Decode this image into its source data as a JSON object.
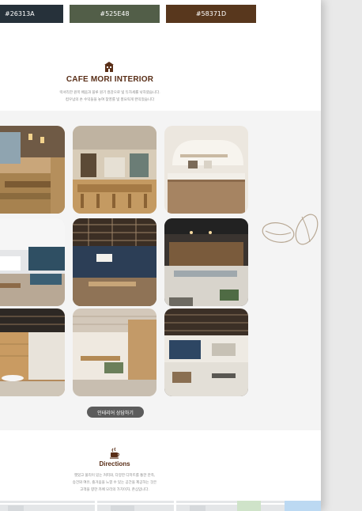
{
  "swatches": [
    {
      "label": "#26313A",
      "color": "#26313A"
    },
    {
      "label": "#525E48",
      "color": "#525E48"
    },
    {
      "label": "#58371D",
      "color": "#58371D"
    }
  ],
  "section": {
    "title": "CAFE MORI INTERIOR",
    "desc_line1": "럭셔리한 원목 배움과 블루 원기 컬감으로 빛 듀자세롤 낚하였습니다.",
    "desc_line2": "컴우넘의 손 수익들을 놓여 찾영를 빛 풍요릭게 완익었습니다",
    "icon": "cafe-building-icon",
    "accent": "#5A2F18"
  },
  "gallery": {
    "tiles": [
      "interior-photo-1",
      "interior-photo-2",
      "interior-photo-3",
      "interior-photo-4",
      "interior-photo-5",
      "interior-photo-6",
      "interior-photo-7",
      "interior-photo-8",
      "interior-photo-9"
    ],
    "button_label": "인테리어 상담하기"
  },
  "directions": {
    "title": "Directions",
    "line1": "햇었고 풀리이 있는 커피와, 다양한 디저트를 통한 만족,",
    "line2": "승건와 여유, 즐거움을 느낄 수 있는 공간을 제공하는 것은",
    "line3": "고객을 향한 카페 모리의 가치이자, 존심입니다.",
    "icon": "coffee-cup-icon"
  }
}
